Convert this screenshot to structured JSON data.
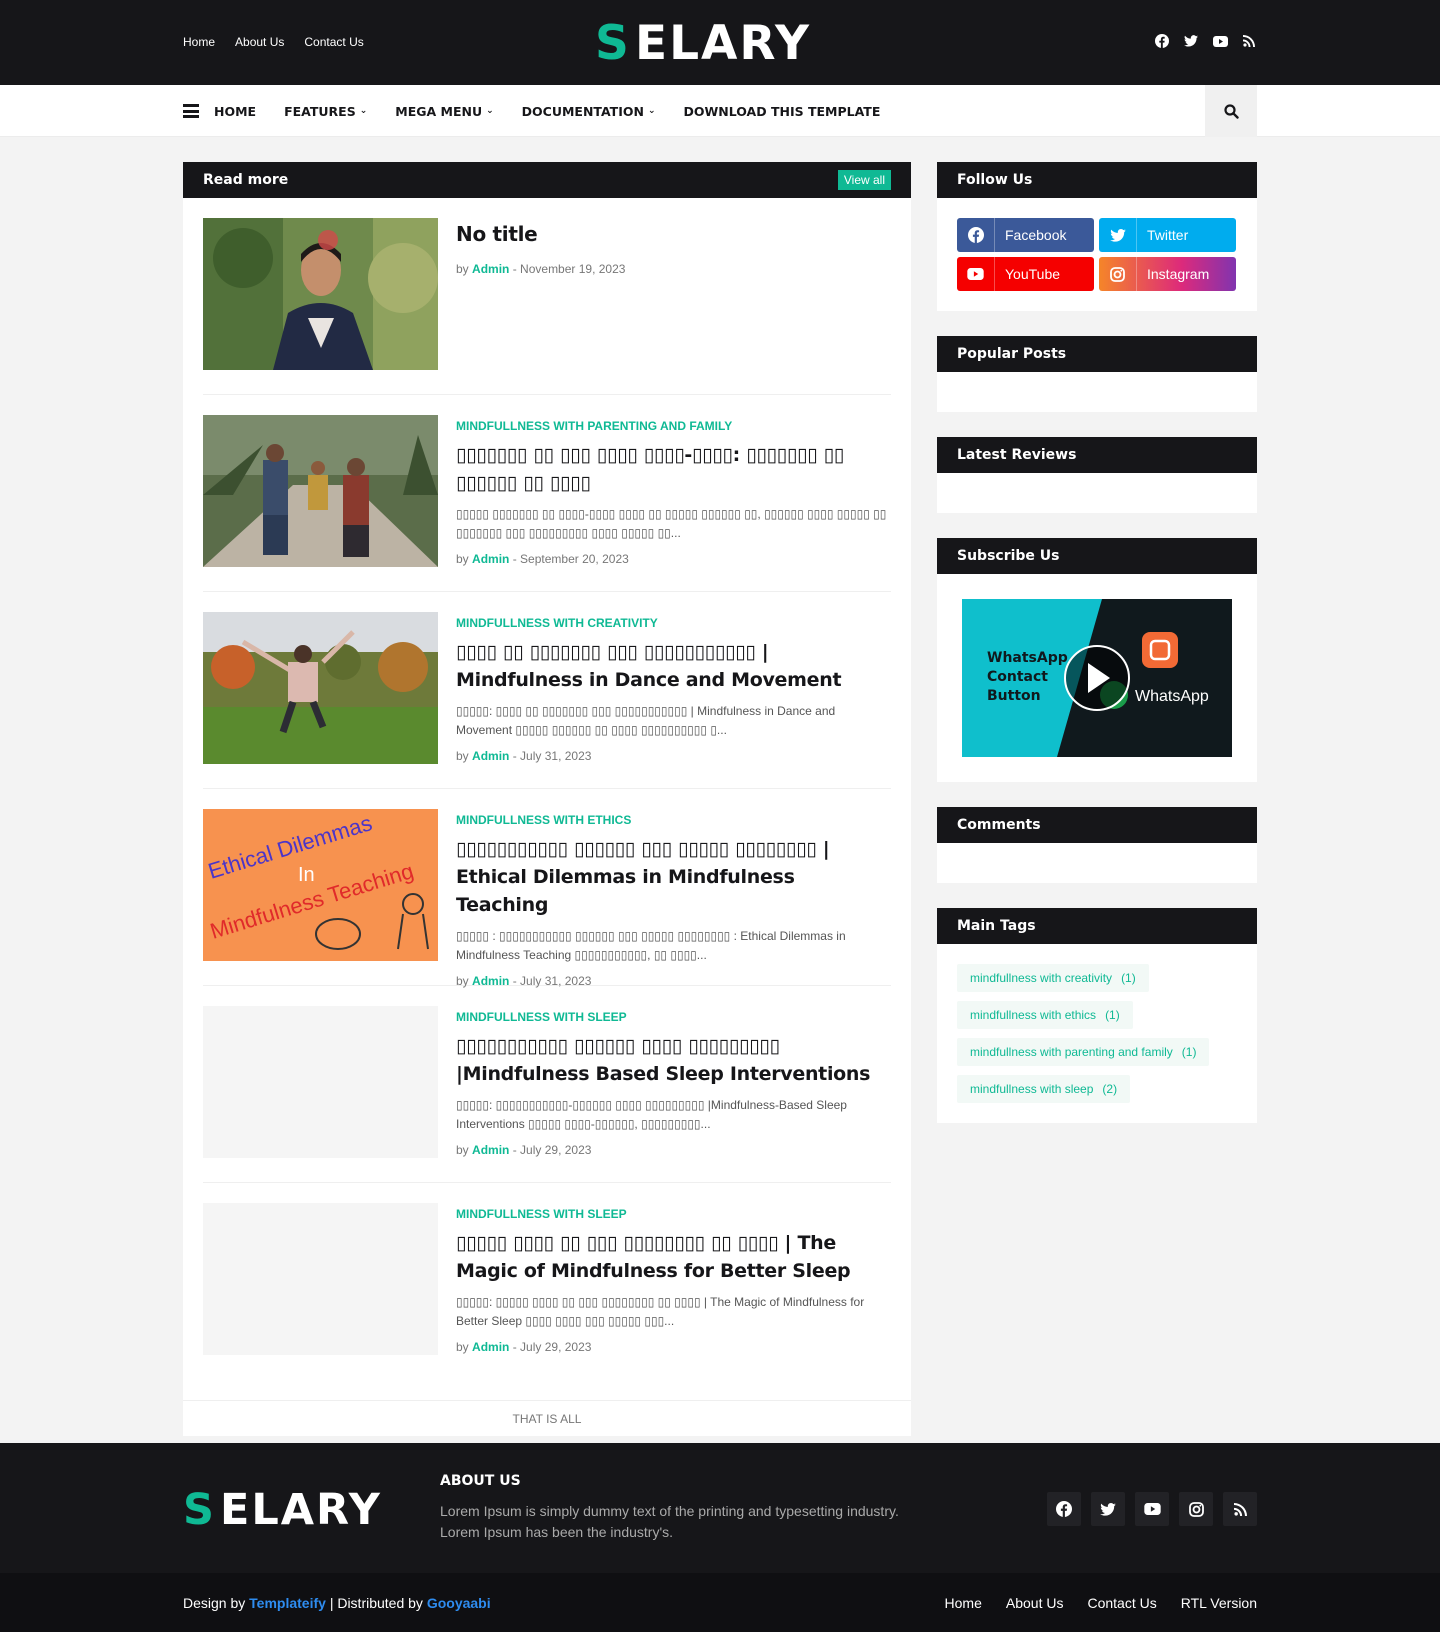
{
  "header": {
    "top_links": [
      "Home",
      "About Us",
      "Contact Us"
    ],
    "logo_text": "SELARY",
    "social_icons": [
      "facebook-icon",
      "twitter-icon",
      "youtube-icon",
      "rss-icon"
    ]
  },
  "nav": {
    "items": [
      {
        "label": "HOME",
        "dropdown": false
      },
      {
        "label": "FEATURES",
        "dropdown": true
      },
      {
        "label": "MEGA MENU",
        "dropdown": true
      },
      {
        "label": "DOCUMENTATION",
        "dropdown": true
      },
      {
        "label": "DOWNLOAD THIS TEMPLATE",
        "dropdown": false
      }
    ]
  },
  "main": {
    "title": "Read more",
    "view_all": "View all",
    "end_text": "THAT IS ALL",
    "posts": [
      {
        "category": "",
        "title": "No title",
        "excerpt": "",
        "by": "by",
        "author": "Admin",
        "date": "- November 19, 2023",
        "thumb": "man-selfie"
      },
      {
        "category": "MINDFULLNESS WITH PARENTING AND FAMILY",
        "title": "▯▯▯▯▯▯▯ ▯▯ ▯▯▯ ▯▯▯▯ ▯▯▯▯-▯▯▯▯: ▯▯▯▯▯▯▯ ▯▯ ▯▯▯▯▯▯ ▯▯ ▯▯▯▯",
        "excerpt": "▯▯▯▯▯ ▯▯▯▯▯▯▯ ▯▯ ▯▯▯▯-▯▯▯▯ ▯▯▯▯ ▯▯ ▯▯▯▯▯ ▯▯▯▯▯▯ ▯▯, ▯▯▯▯▯▯ ▯▯▯▯ ▯▯▯▯▯ ▯▯ ▯▯▯▯▯▯▯ ▯▯▯ ▯▯▯▯▯▯▯▯▯ ▯▯▯▯ ▯▯▯▯▯ ▯▯...",
        "by": "by",
        "author": "Admin",
        "date": "- September 20, 2023",
        "thumb": "family"
      },
      {
        "category": "MINDFULLNESS WITH CREATIVITY",
        "title": "▯▯▯▯ ▯▯ ▯▯▯▯▯▯▯ ▯▯▯ ▯▯▯▯▯▯▯▯▯▯▯ | Mindfulness in Dance and Movement",
        "excerpt": "▯▯▯▯▯: ▯▯▯▯ ▯▯ ▯▯▯▯▯▯▯ ▯▯▯ ▯▯▯▯▯▯▯▯▯▯▯ | Mindfulness in Dance and Movement ▯▯▯▯▯ ▯▯▯▯▯▯ ▯▯ ▯▯▯▯ ▯▯▯▯▯▯▯▯▯▯ ▯...",
        "by": "by",
        "author": "Admin",
        "date": "- July 31, 2023",
        "thumb": "jump"
      },
      {
        "category": "MINDFULLNESS WITH ETHICS",
        "title": "▯▯▯▯▯▯▯▯▯▯▯ ▯▯▯▯▯▯ ▯▯▯ ▯▯▯▯▯ ▯▯▯▯▯▯▯▯ | Ethical Dilemmas in Mindfulness Teaching",
        "excerpt": "▯▯▯▯▯ : ▯▯▯▯▯▯▯▯▯▯▯ ▯▯▯▯▯▯ ▯▯▯ ▯▯▯▯▯ ▯▯▯▯▯▯▯▯ : Ethical Dilemmas in Mindfulness Teaching ▯▯▯▯▯▯▯▯▯▯▯, ▯▯ ▯▯▯▯...",
        "by": "by",
        "author": "Admin",
        "date": "- July 31, 2023",
        "thumb": "ethics"
      },
      {
        "category": "MINDFULLNESS WITH SLEEP",
        "title": "▯▯▯▯▯▯▯▯▯▯▯ ▯▯▯▯▯▯ ▯▯▯▯ ▯▯▯▯▯▯▯▯▯ |Mindfulness Based Sleep Interventions",
        "excerpt": "▯▯▯▯▯: ▯▯▯▯▯▯▯▯▯▯▯-▯▯▯▯▯▯ ▯▯▯▯ ▯▯▯▯▯▯▯▯▯ |Mindfulness-Based Sleep Interventions  ▯▯▯▯▯ ▯▯▯▯-▯▯▯▯▯▯, ▯▯▯▯▯▯▯▯▯...",
        "by": "by",
        "author": "Admin",
        "date": "- July 29, 2023",
        "thumb": "blank"
      },
      {
        "category": "MINDFULLNESS WITH SLEEP",
        "title": "▯▯▯▯▯ ▯▯▯▯ ▯▯ ▯▯▯ ▯▯▯▯▯▯▯▯ ▯▯ ▯▯▯▯ | The Magic of Mindfulness for Better Sleep",
        "excerpt": "▯▯▯▯▯: ▯▯▯▯▯ ▯▯▯▯ ▯▯ ▯▯▯ ▯▯▯▯▯▯▯▯ ▯▯ ▯▯▯▯ | The Magic of Mindfulness for Better Sleep ▯▯▯▯ ▯▯▯▯ ▯▯▯ ▯▯▯▯▯ ▯▯▯...",
        "by": "by",
        "author": "Admin",
        "date": "- July 29, 2023",
        "thumb": "blank"
      }
    ],
    "thumb_texts": {
      "ethics_1": "Ethical Dilemmas",
      "ethics_2": "In",
      "ethics_3": "Mindfulness Teaching"
    }
  },
  "sidebar": {
    "follow_title": "Follow Us",
    "social": [
      {
        "label": "Facebook",
        "color": "#3b5999",
        "icon": "facebook-icon"
      },
      {
        "label": "Twitter",
        "color": "#00acee",
        "icon": "twitter-icon"
      },
      {
        "label": "YouTube",
        "color": "#f50000",
        "icon": "youtube-icon"
      },
      {
        "label": "Instagram",
        "color": "#dd277b",
        "icon": "instagram-icon"
      }
    ],
    "popular_title": "Popular Posts",
    "reviews_title": "Latest Reviews",
    "subscribe_title": "Subscribe Us",
    "video": {
      "left_text_1": "WhatsApp",
      "left_text_2": "Contact",
      "left_text_3": "Button",
      "right_text": "WhatsApp"
    },
    "comments_title": "Comments",
    "tags_title": "Main Tags",
    "tags": [
      {
        "name": "mindfullness with creativity",
        "count": "(1)"
      },
      {
        "name": "mindfullness with ethics",
        "count": "(1)"
      },
      {
        "name": "mindfullness with parenting and family",
        "count": "(1)"
      },
      {
        "name": "mindfullness with sleep",
        "count": "(2)"
      }
    ]
  },
  "footer": {
    "logo_text": "SELARY",
    "about_title": "ABOUT US",
    "about_text": "Lorem Ipsum is simply dummy text of the printing and typesetting industry. Lorem Ipsum has been the industry's.",
    "social_icons": [
      "facebook-icon",
      "twitter-icon",
      "youtube-icon",
      "instagram-icon",
      "rss-icon"
    ],
    "credit_design": "Design by",
    "credit_author": "Templateify",
    "credit_sep": "| Distributed by",
    "credit_dist": "Gooyaabi",
    "links": [
      "Home",
      "About Us",
      "Contact Us",
      "RTL Version"
    ]
  },
  "colors": {
    "accent": "#0fb994",
    "dark": "#161619",
    "link_blue": "#2e8cef"
  }
}
